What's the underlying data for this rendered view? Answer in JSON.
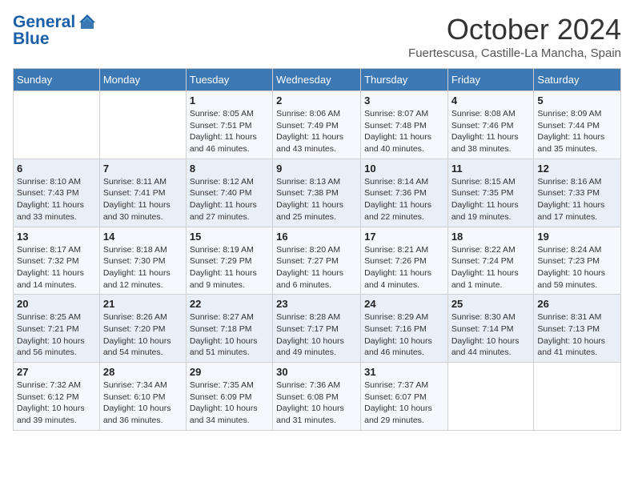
{
  "header": {
    "logo_line1": "General",
    "logo_line2": "Blue",
    "month": "October 2024",
    "location": "Fuertescusa, Castille-La Mancha, Spain"
  },
  "weekdays": [
    "Sunday",
    "Monday",
    "Tuesday",
    "Wednesday",
    "Thursday",
    "Friday",
    "Saturday"
  ],
  "weeks": [
    [
      {
        "day": "",
        "text": ""
      },
      {
        "day": "",
        "text": ""
      },
      {
        "day": "1",
        "text": "Sunrise: 8:05 AM\nSunset: 7:51 PM\nDaylight: 11 hours and 46 minutes."
      },
      {
        "day": "2",
        "text": "Sunrise: 8:06 AM\nSunset: 7:49 PM\nDaylight: 11 hours and 43 minutes."
      },
      {
        "day": "3",
        "text": "Sunrise: 8:07 AM\nSunset: 7:48 PM\nDaylight: 11 hours and 40 minutes."
      },
      {
        "day": "4",
        "text": "Sunrise: 8:08 AM\nSunset: 7:46 PM\nDaylight: 11 hours and 38 minutes."
      },
      {
        "day": "5",
        "text": "Sunrise: 8:09 AM\nSunset: 7:44 PM\nDaylight: 11 hours and 35 minutes."
      }
    ],
    [
      {
        "day": "6",
        "text": "Sunrise: 8:10 AM\nSunset: 7:43 PM\nDaylight: 11 hours and 33 minutes."
      },
      {
        "day": "7",
        "text": "Sunrise: 8:11 AM\nSunset: 7:41 PM\nDaylight: 11 hours and 30 minutes."
      },
      {
        "day": "8",
        "text": "Sunrise: 8:12 AM\nSunset: 7:40 PM\nDaylight: 11 hours and 27 minutes."
      },
      {
        "day": "9",
        "text": "Sunrise: 8:13 AM\nSunset: 7:38 PM\nDaylight: 11 hours and 25 minutes."
      },
      {
        "day": "10",
        "text": "Sunrise: 8:14 AM\nSunset: 7:36 PM\nDaylight: 11 hours and 22 minutes."
      },
      {
        "day": "11",
        "text": "Sunrise: 8:15 AM\nSunset: 7:35 PM\nDaylight: 11 hours and 19 minutes."
      },
      {
        "day": "12",
        "text": "Sunrise: 8:16 AM\nSunset: 7:33 PM\nDaylight: 11 hours and 17 minutes."
      }
    ],
    [
      {
        "day": "13",
        "text": "Sunrise: 8:17 AM\nSunset: 7:32 PM\nDaylight: 11 hours and 14 minutes."
      },
      {
        "day": "14",
        "text": "Sunrise: 8:18 AM\nSunset: 7:30 PM\nDaylight: 11 hours and 12 minutes."
      },
      {
        "day": "15",
        "text": "Sunrise: 8:19 AM\nSunset: 7:29 PM\nDaylight: 11 hours and 9 minutes."
      },
      {
        "day": "16",
        "text": "Sunrise: 8:20 AM\nSunset: 7:27 PM\nDaylight: 11 hours and 6 minutes."
      },
      {
        "day": "17",
        "text": "Sunrise: 8:21 AM\nSunset: 7:26 PM\nDaylight: 11 hours and 4 minutes."
      },
      {
        "day": "18",
        "text": "Sunrise: 8:22 AM\nSunset: 7:24 PM\nDaylight: 11 hours and 1 minute."
      },
      {
        "day": "19",
        "text": "Sunrise: 8:24 AM\nSunset: 7:23 PM\nDaylight: 10 hours and 59 minutes."
      }
    ],
    [
      {
        "day": "20",
        "text": "Sunrise: 8:25 AM\nSunset: 7:21 PM\nDaylight: 10 hours and 56 minutes."
      },
      {
        "day": "21",
        "text": "Sunrise: 8:26 AM\nSunset: 7:20 PM\nDaylight: 10 hours and 54 minutes."
      },
      {
        "day": "22",
        "text": "Sunrise: 8:27 AM\nSunset: 7:18 PM\nDaylight: 10 hours and 51 minutes."
      },
      {
        "day": "23",
        "text": "Sunrise: 8:28 AM\nSunset: 7:17 PM\nDaylight: 10 hours and 49 minutes."
      },
      {
        "day": "24",
        "text": "Sunrise: 8:29 AM\nSunset: 7:16 PM\nDaylight: 10 hours and 46 minutes."
      },
      {
        "day": "25",
        "text": "Sunrise: 8:30 AM\nSunset: 7:14 PM\nDaylight: 10 hours and 44 minutes."
      },
      {
        "day": "26",
        "text": "Sunrise: 8:31 AM\nSunset: 7:13 PM\nDaylight: 10 hours and 41 minutes."
      }
    ],
    [
      {
        "day": "27",
        "text": "Sunrise: 7:32 AM\nSunset: 6:12 PM\nDaylight: 10 hours and 39 minutes."
      },
      {
        "day": "28",
        "text": "Sunrise: 7:34 AM\nSunset: 6:10 PM\nDaylight: 10 hours and 36 minutes."
      },
      {
        "day": "29",
        "text": "Sunrise: 7:35 AM\nSunset: 6:09 PM\nDaylight: 10 hours and 34 minutes."
      },
      {
        "day": "30",
        "text": "Sunrise: 7:36 AM\nSunset: 6:08 PM\nDaylight: 10 hours and 31 minutes."
      },
      {
        "day": "31",
        "text": "Sunrise: 7:37 AM\nSunset: 6:07 PM\nDaylight: 10 hours and 29 minutes."
      },
      {
        "day": "",
        "text": ""
      },
      {
        "day": "",
        "text": ""
      }
    ]
  ]
}
